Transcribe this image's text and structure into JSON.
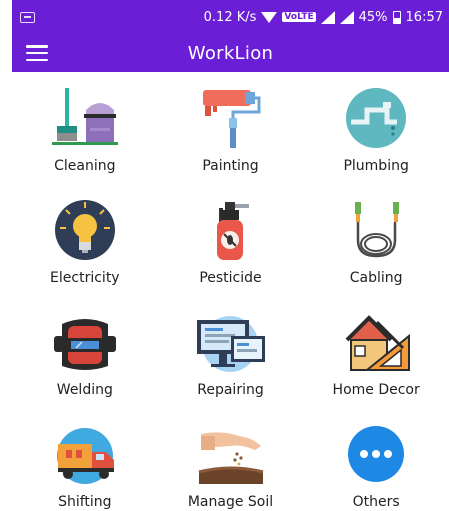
{
  "status_bar": {
    "speed": "0.12 K/s",
    "volte": "VoLTE",
    "battery": "45%",
    "time": "16:57"
  },
  "app_bar": {
    "title": "WorkLion"
  },
  "services": [
    {
      "label": "Cleaning",
      "icon": "cleaning-icon"
    },
    {
      "label": "Painting",
      "icon": "paint-roller-icon"
    },
    {
      "label": "Plumbing",
      "icon": "pipes-icon"
    },
    {
      "label": "Electricity",
      "icon": "light-bulb-icon"
    },
    {
      "label": "Pesticide",
      "icon": "spray-bottle-icon"
    },
    {
      "label": "Cabling",
      "icon": "cable-icon"
    },
    {
      "label": "Welding",
      "icon": "welding-mask-icon"
    },
    {
      "label": "Repairing",
      "icon": "computer-screens-icon"
    },
    {
      "label": "Home Decor",
      "icon": "house-tools-icon"
    },
    {
      "label": "Shifting",
      "icon": "truck-icon"
    },
    {
      "label": "Manage Soil",
      "icon": "soil-hand-icon"
    },
    {
      "label": "Others",
      "icon": "more-dots-icon"
    }
  ],
  "colors": {
    "primary": "#6a1fd6"
  }
}
